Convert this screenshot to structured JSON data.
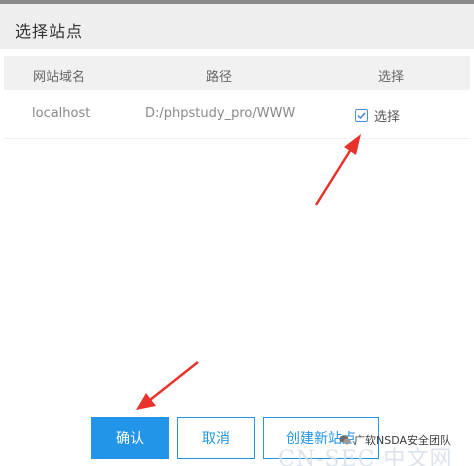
{
  "dialog": {
    "title": "选择站点"
  },
  "table": {
    "headers": {
      "domain": "网站域名",
      "path": "路径",
      "select": "选择"
    },
    "rows": [
      {
        "domain": "localhost",
        "path": "D:/phpstudy_pro/WWW",
        "selected": true,
        "select_label": "选择"
      }
    ]
  },
  "buttons": {
    "confirm": "确认",
    "cancel": "取消",
    "new_site": "创建新站点"
  },
  "watermark": {
    "label": "广软NSDA安全团队",
    "background_text": "CN-SEC 中文网"
  },
  "colors": {
    "accent": "#2295e8",
    "arrow": "#e8332a",
    "header_bg": "#eeeeee"
  }
}
